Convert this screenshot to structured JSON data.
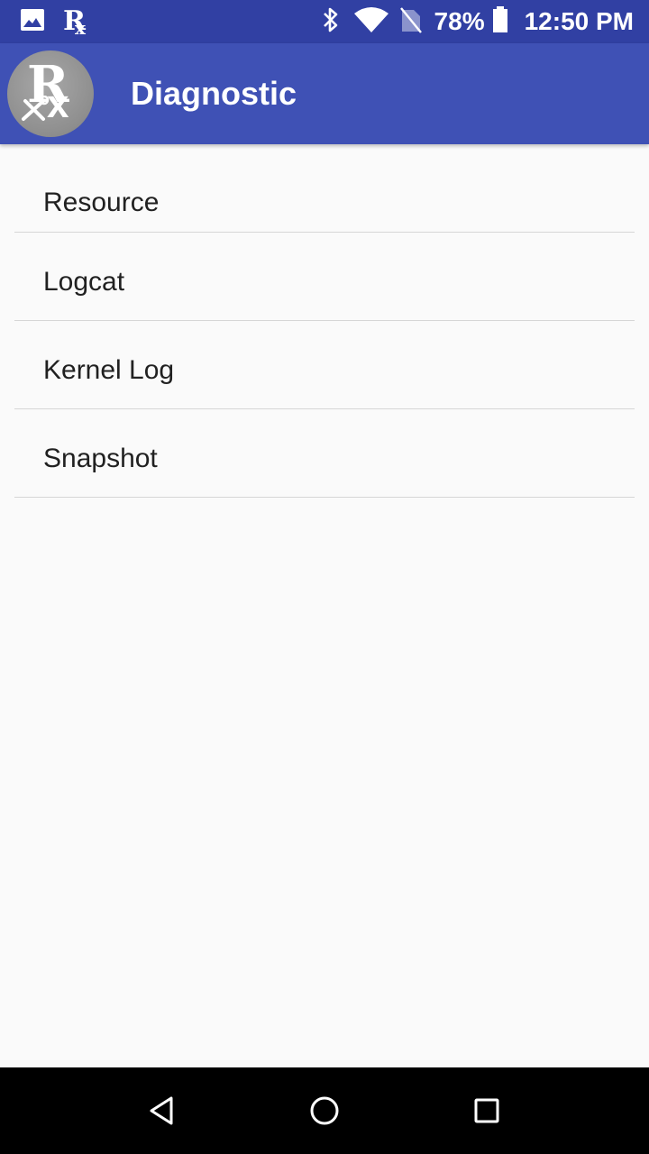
{
  "status_bar": {
    "battery_percent": "78%",
    "time": "12:50 PM",
    "icons": [
      "image-icon",
      "rx-icon",
      "bluetooth-icon",
      "wifi-icon",
      "no-sim-icon",
      "battery-icon"
    ]
  },
  "app_bar": {
    "title": "Diagnostic",
    "logo_letters_r": "R",
    "logo_letters_x": "x",
    "color": "#3f51b5",
    "status_color": "#3140a3"
  },
  "menu": {
    "items": [
      {
        "label": "Resource"
      },
      {
        "label": "Logcat"
      },
      {
        "label": "Kernel Log"
      },
      {
        "label": "Snapshot"
      }
    ]
  },
  "nav_bar": {
    "icons": [
      "back-icon",
      "home-icon",
      "recents-icon"
    ]
  }
}
